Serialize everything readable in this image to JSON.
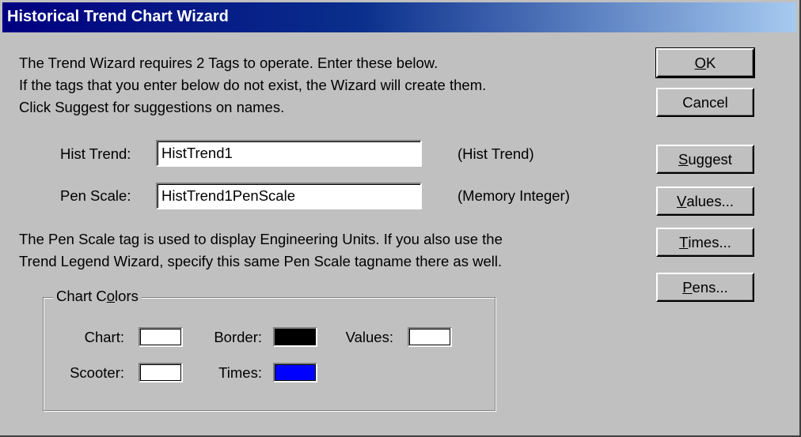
{
  "window": {
    "title": "Historical Trend Chart Wizard"
  },
  "intro": {
    "lines": [
      "The Trend Wizard requires 2 Tags to operate.  Enter these below.",
      "If the tags that you enter below do not exist, the Wizard will create them.",
      "Click Suggest for suggestions on names."
    ]
  },
  "fields": {
    "hist_trend": {
      "label": "Hist Trend:",
      "value": "HistTrend1",
      "type_note": "(Hist Trend)"
    },
    "pen_scale": {
      "label": "Pen Scale:",
      "value": "HistTrend1PenScale",
      "type_note": "(Memory Integer)"
    }
  },
  "note": {
    "lines": [
      "The Pen Scale tag is used to display Engineering Units.  If you also use the",
      "Trend Legend Wizard, specify this same Pen Scale tagname there as well."
    ]
  },
  "chart_colors": {
    "legend_pre": "Chart C",
    "legend_acc": "o",
    "legend_post": "lors",
    "chart": {
      "label": "Chart:",
      "color": "#ffffff"
    },
    "border": {
      "label": "Border:",
      "color": "#000000"
    },
    "values": {
      "label": "Values:",
      "color": "#ffffff"
    },
    "scooter": {
      "label": "Scooter:",
      "color": "#ffffff"
    },
    "times": {
      "label": "Times:",
      "color": "#0000ff"
    }
  },
  "buttons": {
    "ok": {
      "acc": "O",
      "rest": "K"
    },
    "cancel": {
      "label": "Cancel"
    },
    "suggest": {
      "acc": "S",
      "rest": "uggest"
    },
    "values": {
      "acc": "V",
      "rest": "alues..."
    },
    "times": {
      "acc": "T",
      "rest": "imes..."
    },
    "pens": {
      "acc": "P",
      "rest": "ens..."
    }
  }
}
